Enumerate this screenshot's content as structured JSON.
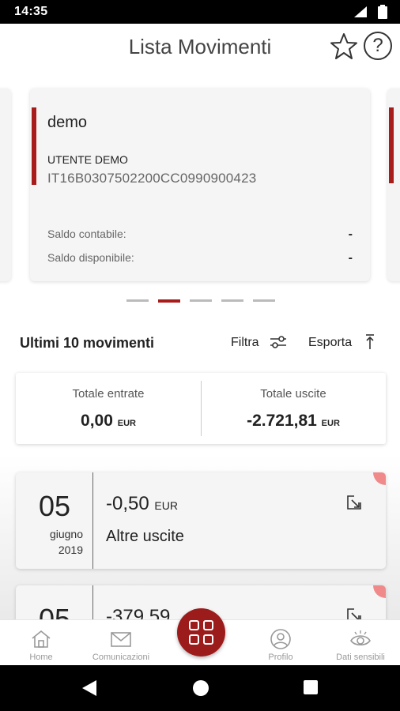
{
  "status_bar": {
    "time": "14:35"
  },
  "header": {
    "title": "Lista Movimenti"
  },
  "account_card": {
    "name": "demo",
    "holder": "UTENTE DEMO",
    "iban": "IT16B0307502200CC0990900423",
    "saldo_contabile_label": "Saldo contabile:",
    "saldo_contabile_value": "-",
    "saldo_disponibile_label": "Saldo disponibile:",
    "saldo_disponibile_value": "-"
  },
  "carousel": {
    "pages": 5,
    "active_index": 1
  },
  "movements_section": {
    "title": "Ultimi 10 movimenti",
    "filter_label": "Filtra",
    "export_label": "Esporta"
  },
  "totals": {
    "in_label": "Totale entrate",
    "in_amount": "0,00",
    "in_currency": "EUR",
    "out_label": "Totale uscite",
    "out_amount": "-2.721,81",
    "out_currency": "EUR"
  },
  "movements": [
    {
      "day": "05",
      "month": "giugno",
      "year": "2019",
      "amount": "-0,50",
      "currency": "EUR",
      "description": "Altre uscite"
    },
    {
      "day": "05",
      "amount": "-379,59"
    }
  ],
  "bottom_nav": {
    "home": "Home",
    "comunicazioni": "Comunicazioni",
    "profilo": "Profilo",
    "dati_sensibili": "Dati sensibili"
  },
  "colors": {
    "accent": "#a81c1c",
    "fab": "#9c1b1b",
    "corner_badge": "#f08a8a"
  }
}
